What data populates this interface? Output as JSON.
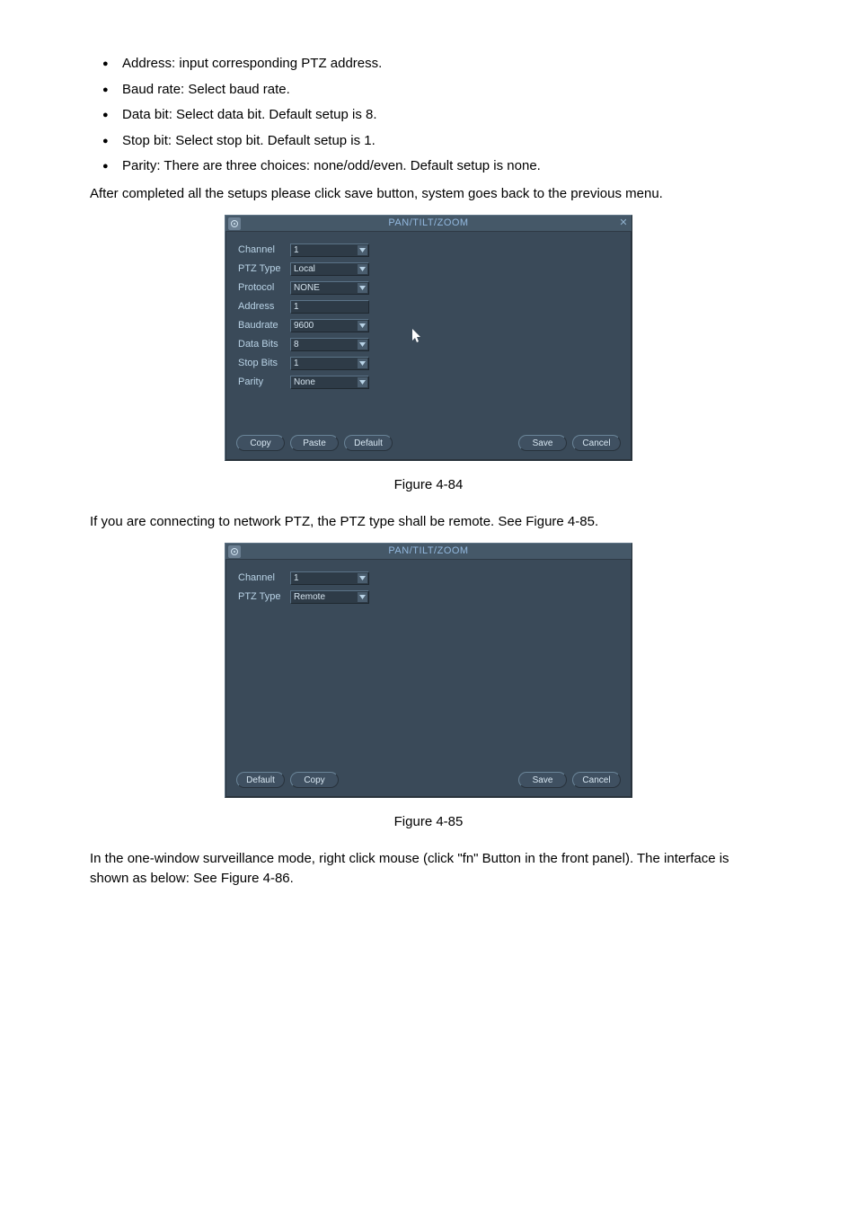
{
  "bullets": [
    "Address: input corresponding PTZ address.",
    "Baud rate: Select baud rate.",
    "Data bit: Select data bit. Default setup is 8.",
    "Stop bit: Select stop bit. Default setup is 1.",
    "Parity: There are three choices: none/odd/even.  Default setup is none."
  ],
  "para1": "After completed all the setups please click save button, system goes back to the previous menu.",
  "caption1": "Figure 4-84",
  "para2": "If you are connecting to network PTZ, the PTZ type shall be remote. See Figure 4-85.",
  "caption2": "Figure 4-85",
  "para3": "In the one-window surveillance mode, right click mouse (click \"fn\" Button in the front panel). The interface is shown as below: See Figure 4-86.",
  "dialog1": {
    "title": "PAN/TILT/ZOOM",
    "fields": {
      "channel_label": "Channel",
      "channel_value": "1",
      "ptztype_label": "PTZ Type",
      "ptztype_value": "Local",
      "protocol_label": "Protocol",
      "protocol_value": "NONE",
      "address_label": "Address",
      "address_value": "1",
      "baudrate_label": "Baudrate",
      "baudrate_value": "9600",
      "databits_label": "Data Bits",
      "databits_value": "8",
      "stopbits_label": "Stop Bits",
      "stopbits_value": "1",
      "parity_label": "Parity",
      "parity_value": "None"
    },
    "buttons": {
      "copy": "Copy",
      "paste": "Paste",
      "default": "Default",
      "save": "Save",
      "cancel": "Cancel"
    }
  },
  "dialog2": {
    "title": "PAN/TILT/ZOOM",
    "fields": {
      "channel_label": "Channel",
      "channel_value": "1",
      "ptztype_label": "PTZ Type",
      "ptztype_value": "Remote"
    },
    "buttons": {
      "default": "Default",
      "copy": "Copy",
      "save": "Save",
      "cancel": "Cancel"
    }
  }
}
